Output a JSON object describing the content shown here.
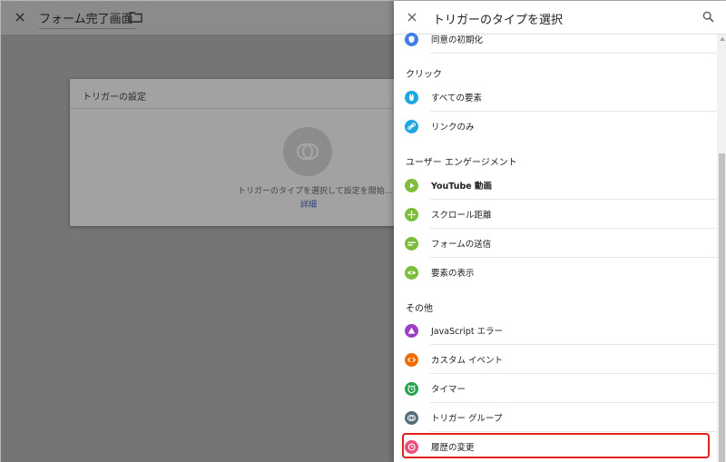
{
  "editor": {
    "title": "フォーム完了画面",
    "card_title": "トリガーの設定",
    "card_hint": "トリガーのタイプを選択して設定を開始...",
    "card_link": "詳細"
  },
  "panel": {
    "title": "トリガーのタイプを選択",
    "top_item": {
      "label": "同意の初期化",
      "icon": "shield-icon",
      "color": "#3f7ee8"
    },
    "sections": [
      {
        "title": "クリック",
        "items": [
          {
            "label": "すべての要素",
            "icon": "mouse-icon",
            "color": "#1ea7e0"
          },
          {
            "label": "リンクのみ",
            "icon": "link-icon",
            "color": "#1ea7e0"
          }
        ]
      },
      {
        "title": "ユーザー エンゲージメント",
        "items": [
          {
            "label": "YouTube 動画",
            "icon": "play-icon",
            "color": "#7cbd3c"
          },
          {
            "label": "スクロール距離",
            "icon": "move-icon",
            "color": "#7cbd3c"
          },
          {
            "label": "フォームの送信",
            "icon": "form-icon",
            "color": "#7cbd3c"
          },
          {
            "label": "要素の表示",
            "icon": "eye-icon",
            "color": "#7cbd3c"
          }
        ]
      },
      {
        "title": "その他",
        "items": [
          {
            "label": "JavaScript エラー",
            "icon": "warning-icon",
            "color": "#9c3fc4"
          },
          {
            "label": "カスタム イベント",
            "icon": "code-icon",
            "color": "#ef6c00"
          },
          {
            "label": "タイマー",
            "icon": "alarm-icon",
            "color": "#26a24b"
          },
          {
            "label": "トリガー グループ",
            "icon": "group-icon",
            "color": "#546e7a"
          },
          {
            "label": "履歴の変更",
            "icon": "history-icon",
            "color": "#ec4d7a"
          }
        ]
      }
    ],
    "highlighted_item": "履歴の変更",
    "highlight_color": "#e0201c"
  }
}
